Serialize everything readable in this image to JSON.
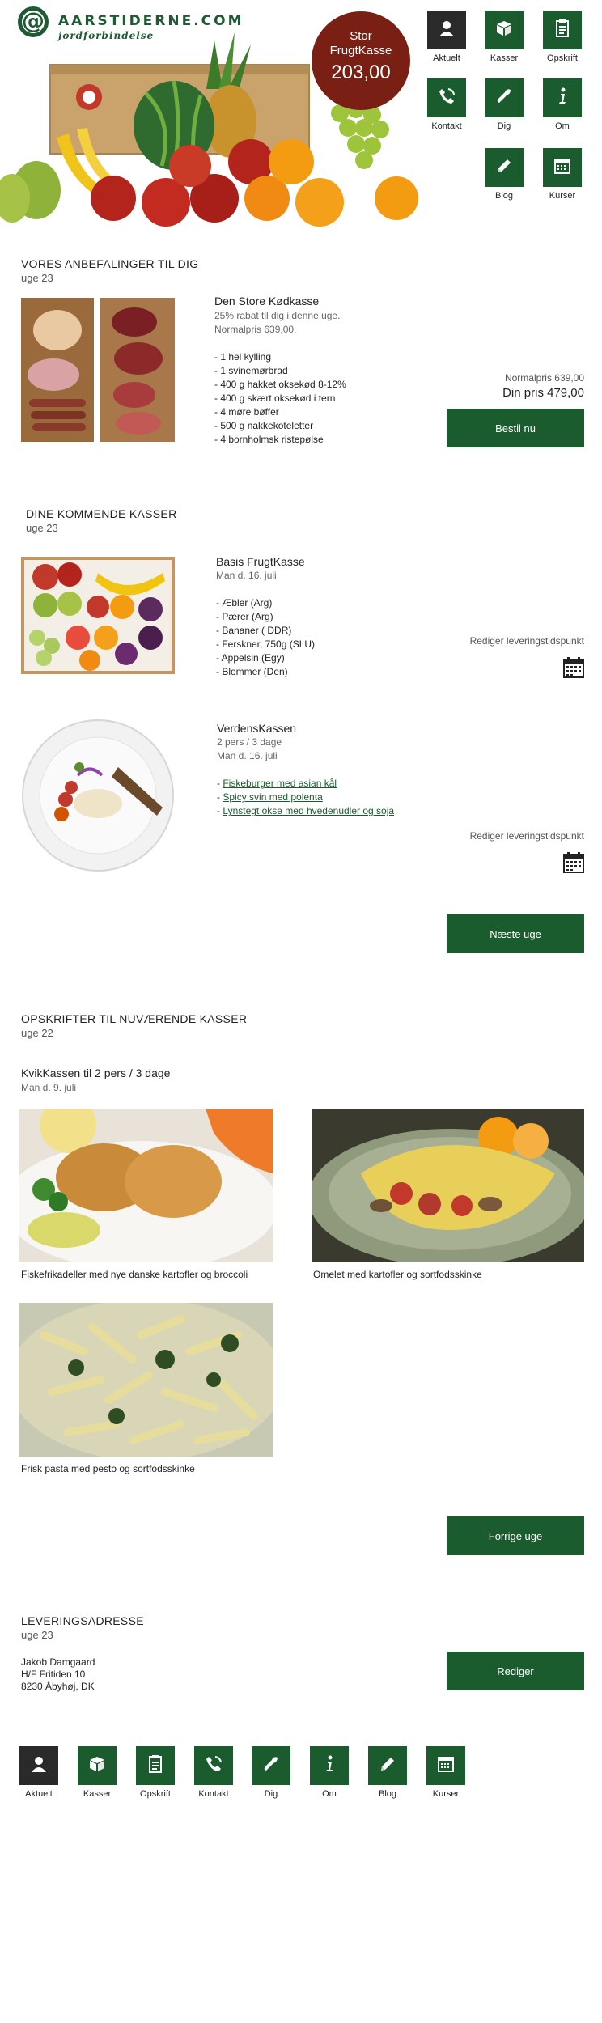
{
  "header": {
    "logo_mark": "@",
    "brand": "AARSTIDERNE.COM",
    "tagline": "jordforbindelse",
    "promo_title_1": "Stor",
    "promo_title_2": "FrugtKasse",
    "promo_price": "203,00"
  },
  "nav": [
    {
      "label": "Aktuelt",
      "icon": "user-icon",
      "active": true
    },
    {
      "label": "Kasser",
      "icon": "box-icon"
    },
    {
      "label": "Opskrift",
      "icon": "recipe-icon"
    },
    {
      "label": "Kontakt",
      "icon": "phone-icon"
    },
    {
      "label": "Dig",
      "icon": "wrench-icon"
    },
    {
      "label": "Om",
      "icon": "info-icon"
    },
    {
      "label": "Blog",
      "icon": "pencil-icon"
    },
    {
      "label": "Kurser",
      "icon": "calendar-icon"
    }
  ],
  "recommend": {
    "title": "VORES ANBEFALINGER TIL DIG",
    "week": "uge 23",
    "item_title": "Den Store Kødkasse",
    "item_line1": "25% rabat til dig i denne uge.",
    "item_line2": "Normalpris 639,00.",
    "items": [
      "- 1 hel kylling",
      "- 1 svinemørbrad",
      "- 400 g hakket oksekød 8-12%",
      "- 400 g skært oksekød i tern",
      "- 4 møre bøffer",
      "- 500 g nakkekoteletter",
      "- 4 bornholmsk ristepølse"
    ],
    "normal_price": "Normalpris 639,00",
    "your_price": "Din pris 479,00",
    "button": "Bestil nu"
  },
  "upcoming": {
    "title": "DINE KOMMENDE KASSER",
    "week": "uge 23",
    "box1_title": "Basis FrugtKasse",
    "box1_date": "Man d. 16. juli",
    "box1_items": [
      "- Æbler (Arg)",
      "- Pærer (Arg)",
      "- Bananer ( DDR)",
      "- Ferskner, 750g (SLU)",
      "- Appelsin (Egy)",
      "- Blommer (Den)"
    ],
    "box1_edit": "Rediger leveringstidspunkt",
    "box2_title": "VerdensKassen",
    "box2_persons": "2 pers / 3 dage",
    "box2_date": "Man d. 16. juli",
    "box2_items": [
      "Fiskeburger med asian kål",
      "Spicy svin med polenta",
      "Lynstegt okse med hvedenudler og soja"
    ],
    "box2_edit": "Rediger leveringstidspunkt",
    "next_button": "Næste uge"
  },
  "recipes": {
    "title": "OPSKRIFTER TIL NUVÆRENDE KASSER",
    "week": "uge 22",
    "box_title": "KvikKassen til 2 pers / 3 dage",
    "box_date": "Man d. 9. juli",
    "captions": [
      "Fiskefrikadeller med nye danske kartofler og broccoli",
      "Omelet med kartofler og sortfodsskinke",
      "Frisk pasta med pesto og sortfodsskinke"
    ],
    "prev_button": "Forrige uge"
  },
  "address": {
    "title": "LEVERINGSADRESSE",
    "week": "uge 23",
    "line1": "Jakob Damgaard",
    "line2": "H/F Fritiden 10",
    "line3": "8230 Åbyhøj, DK",
    "edit_button": "Rediger"
  },
  "colors": {
    "green": "#1a5c2e",
    "dark": "#2a2a2a",
    "promo": "#7a1f14"
  }
}
